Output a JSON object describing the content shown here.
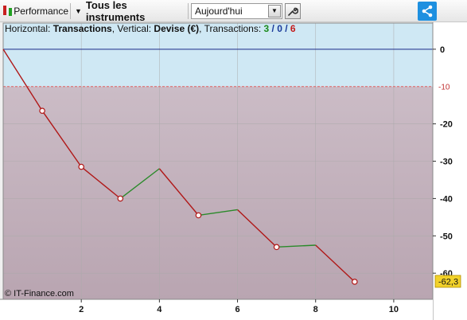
{
  "toolbar": {
    "performance_label": "Performance",
    "instruments_label": "Tous les instruments",
    "period_value": "Aujourd'hui"
  },
  "header": {
    "horizontal_prefix": "Horizontal: ",
    "horizontal_value": "Transactions",
    "vertical_prefix": ", Vertical: ",
    "vertical_value": "Devise (€)",
    "transactions_prefix": ", Transactions: ",
    "winning": "3",
    "slash1": " / ",
    "neutral": "0",
    "slash2": " / ",
    "losing": "6"
  },
  "watermark": "© IT-Finance.com",
  "colors": {
    "gain_zone": "#cfe8f4",
    "loss_zone": "#c4b4be",
    "loss_line": "#b01818",
    "gain_line": "#2a8a2a",
    "zero_line": "#1a2a8a",
    "threshold_line": "#e06060",
    "last_value_badge": "#f2d22a",
    "share_button": "#1e90e0"
  },
  "chart_data": {
    "type": "line",
    "title": "",
    "xlabel": "",
    "ylabel": "",
    "x": [
      0,
      1,
      2,
      3,
      4,
      5,
      6,
      7,
      8,
      9
    ],
    "y": [
      0,
      -16.5,
      -31.5,
      -40,
      -32,
      -44.5,
      -43,
      -53,
      -52.5,
      -62.3
    ],
    "trade_result": [
      "start",
      "loss",
      "loss",
      "loss",
      "gain",
      "loss",
      "gain",
      "loss",
      "gain",
      "loss"
    ],
    "xlim": [
      0,
      11
    ],
    "ylim": [
      -67,
      7
    ],
    "x_ticks": [
      2,
      4,
      6,
      8,
      10
    ],
    "x_tick_labels": [
      "2",
      "4",
      "6",
      "8",
      "10"
    ],
    "y_ticks": [
      0,
      -20,
      -30,
      -40,
      -50,
      -60
    ],
    "y_tick_labels": [
      "0",
      "-20",
      "-30",
      "-40",
      "-50",
      "-60"
    ],
    "threshold": {
      "value": -10,
      "label": "-10"
    },
    "last_value_label": "-62,3",
    "grid": true
  }
}
